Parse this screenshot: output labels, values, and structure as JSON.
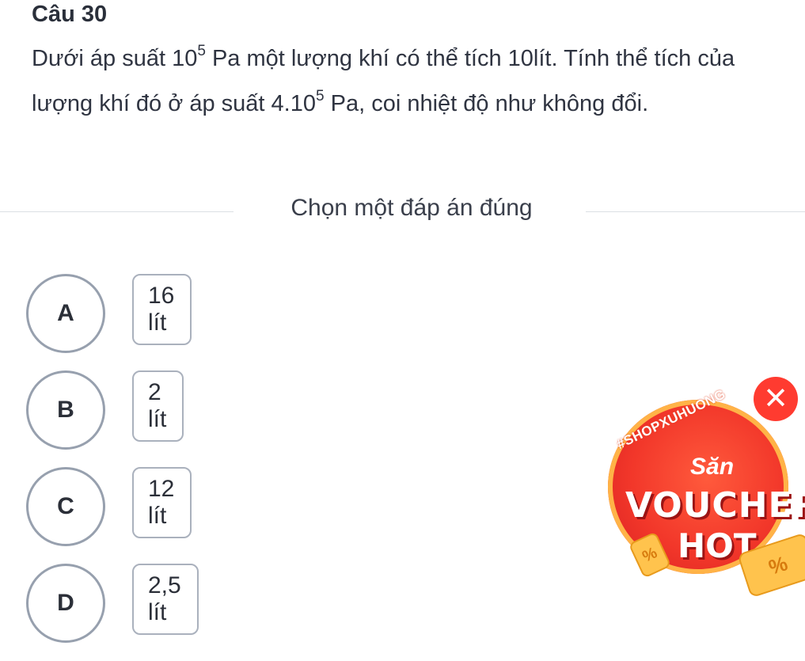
{
  "question": {
    "title": "Câu 30",
    "line1_before": "Dưới áp suất ",
    "p1_base": "10",
    "p1_exp": "5",
    "line1_after": " Pa một lượng khí có thể tích 10lít. Tính thể tích của lượng khí đó ở áp suất ",
    "p2_base": "4.10",
    "p2_exp": "5",
    "line1_end": " Pa, coi nhiệt độ như không đổi."
  },
  "prompt": "Chọn một đáp án đúng",
  "options": [
    {
      "letter": "A",
      "text": "16 lít"
    },
    {
      "letter": "B",
      "text": "2 lít"
    },
    {
      "letter": "C",
      "text": "12 lít"
    },
    {
      "letter": "D",
      "text": "2,5 lít"
    }
  ],
  "promo": {
    "hashtag": "#SHOPXUHUONG",
    "san": "Săn",
    "voucher": "VOUCHER",
    "hot": "HOT",
    "coin_symbol": "%",
    "close_symbol": "✕"
  },
  "colors": {
    "option_border": "#97a0ae",
    "promo_red": "#f2372a",
    "promo_gold": "#ffc34d"
  }
}
